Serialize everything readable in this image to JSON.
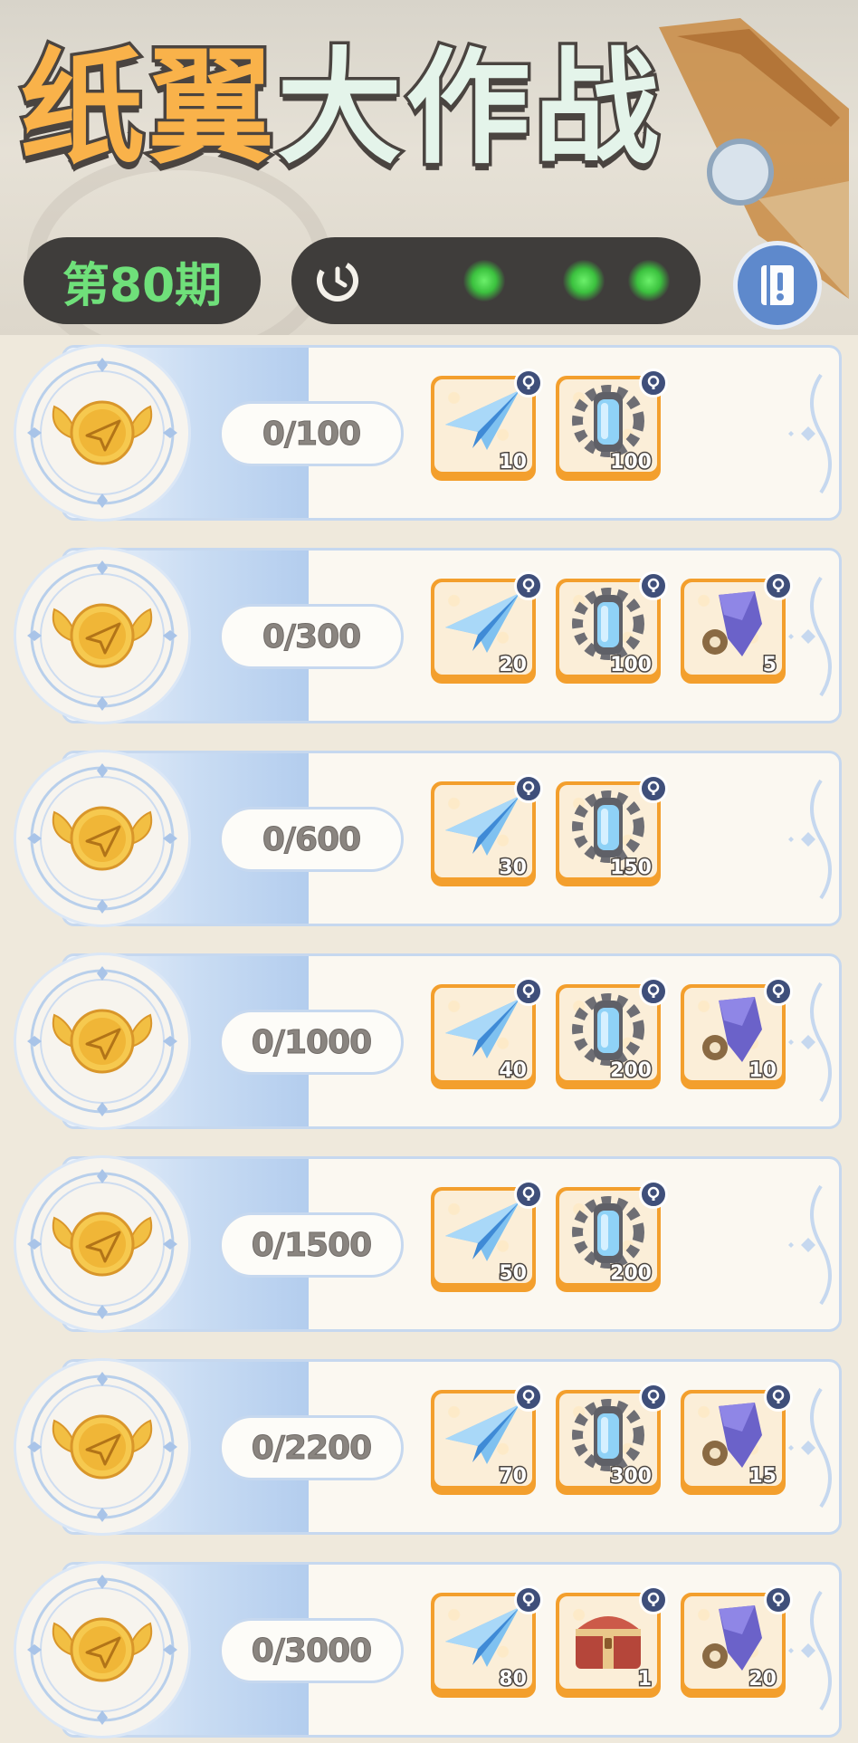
{
  "header": {
    "title_part1": "纸翼",
    "title_part2": "大作战",
    "issue_label": "第80期",
    "timer_icon": "clock-icon",
    "guide_icon": "book-icon"
  },
  "colors": {
    "issue_text": "#6fe07a",
    "reward_frame": "#f39f2d",
    "band": "#b3cdee"
  },
  "milestones": [
    {
      "progress": "0/100",
      "rewards": [
        {
          "type": "paper-plane",
          "count": "10"
        },
        {
          "type": "gear-capsule",
          "count": "100"
        }
      ]
    },
    {
      "progress": "0/300",
      "rewards": [
        {
          "type": "paper-plane",
          "count": "20"
        },
        {
          "type": "gear-capsule",
          "count": "100"
        },
        {
          "type": "crystal-gear",
          "count": "5"
        }
      ]
    },
    {
      "progress": "0/600",
      "rewards": [
        {
          "type": "paper-plane",
          "count": "30"
        },
        {
          "type": "gear-capsule",
          "count": "150"
        }
      ]
    },
    {
      "progress": "0/1000",
      "rewards": [
        {
          "type": "paper-plane",
          "count": "40"
        },
        {
          "type": "gear-capsule",
          "count": "200"
        },
        {
          "type": "crystal-gear",
          "count": "10"
        }
      ]
    },
    {
      "progress": "0/1500",
      "rewards": [
        {
          "type": "paper-plane",
          "count": "50"
        },
        {
          "type": "gear-capsule",
          "count": "200"
        }
      ]
    },
    {
      "progress": "0/2200",
      "rewards": [
        {
          "type": "paper-plane",
          "count": "70"
        },
        {
          "type": "gear-capsule",
          "count": "300"
        },
        {
          "type": "crystal-gear",
          "count": "15"
        }
      ]
    },
    {
      "progress": "0/3000",
      "rewards": [
        {
          "type": "paper-plane",
          "count": "80"
        },
        {
          "type": "treasure-chest",
          "count": "1"
        },
        {
          "type": "crystal-gear",
          "count": "20"
        }
      ]
    }
  ]
}
